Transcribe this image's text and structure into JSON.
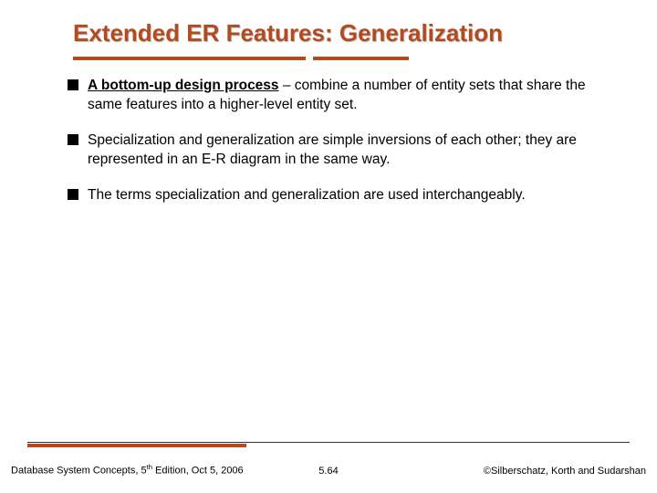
{
  "title": "Extended ER Features: Generalization",
  "bullets": [
    {
      "bold_underlined": "A bottom-up design process",
      "rest": " – combine a number of entity sets that share the same features into a higher-level entity set."
    },
    {
      "text": "Specialization and generalization are simple inversions of each other; they are represented in an E-R diagram in the same way."
    },
    {
      "text": "The terms specialization and generalization are used interchangeably."
    }
  ],
  "footer": {
    "left_prefix": "Database System Concepts, 5",
    "left_super": "th",
    "left_suffix": " Edition, Oct 5, 2006",
    "center": "5.64",
    "right": "©Silberschatz, Korth and Sudarshan"
  }
}
